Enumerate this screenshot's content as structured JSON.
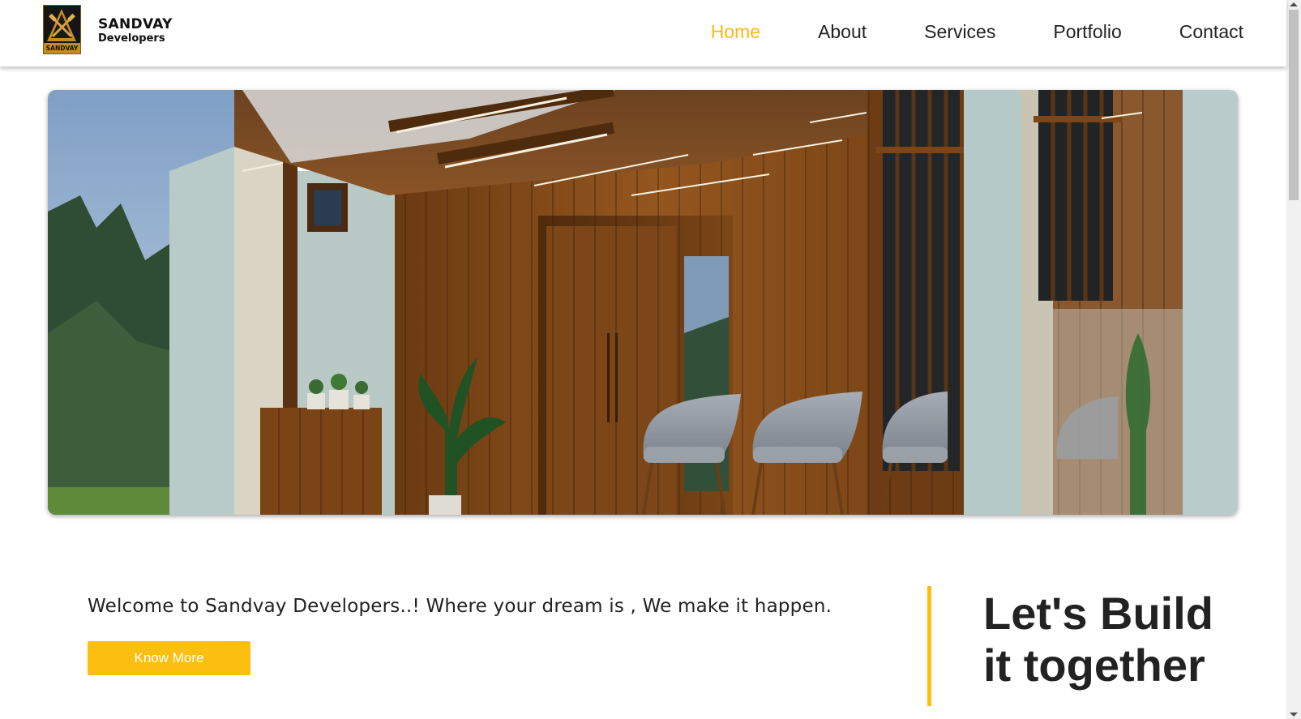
{
  "brand": {
    "name": "SANDVAY",
    "subtitle": "Developers",
    "logo_text": "SANDVAY",
    "accent_color": "#fdbf0f"
  },
  "nav": {
    "items": [
      {
        "label": "Home",
        "active": true
      },
      {
        "label": "About",
        "active": false
      },
      {
        "label": "Services",
        "active": false
      },
      {
        "label": "Portfolio",
        "active": false
      },
      {
        "label": "Contact",
        "active": false
      }
    ]
  },
  "hero": {
    "image": "office-waiting-room-wood-interior-render"
  },
  "welcome": {
    "text": "Welcome to Sandvay Developers..! Where your dream is , We make it happen.",
    "button_label": "Know More"
  },
  "tagline": {
    "line1": "Let's Build",
    "line2": "it together"
  }
}
